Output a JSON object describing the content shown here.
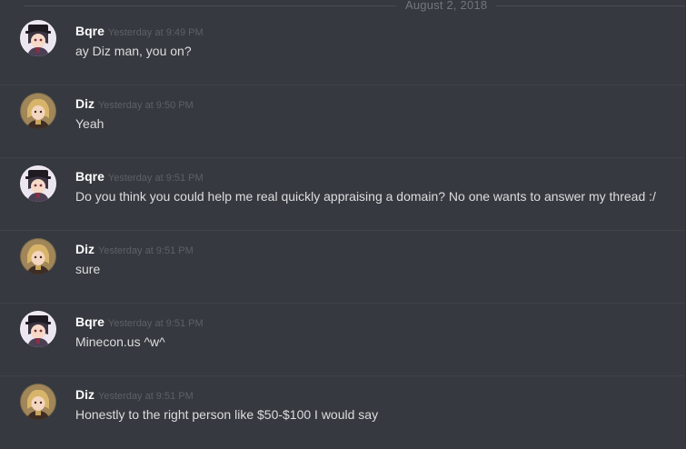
{
  "chat": {
    "date_divider": "August 2, 2018",
    "messages": [
      {
        "author": "Bqre",
        "timestamp": "Yesterday at 9:49 PM",
        "text": "ay Diz man, you on?",
        "avatar_icon": "avatar-bqre-icon"
      },
      {
        "author": "Diz",
        "timestamp": "Yesterday at 9:50 PM",
        "text": "Yeah",
        "avatar_icon": "avatar-diz-icon"
      },
      {
        "author": "Bqre",
        "timestamp": "Yesterday at 9:51 PM",
        "text": "Do you think you could help me real quickly appraising a domain? No one wants to answer my thread :/",
        "avatar_icon": "avatar-bqre-icon"
      },
      {
        "author": "Diz",
        "timestamp": "Yesterday at 9:51 PM",
        "text": "sure",
        "avatar_icon": "avatar-diz-icon"
      },
      {
        "author": "Bqre",
        "timestamp": "Yesterday at 9:51 PM",
        "text": "Minecon.us ^w^",
        "avatar_icon": "avatar-bqre-icon"
      },
      {
        "author": "Diz",
        "timestamp": "Yesterday at 9:51 PM",
        "text": "Honestly to the right person like $50-$100 I would say",
        "avatar_icon": "avatar-diz-icon"
      }
    ]
  },
  "colors": {
    "background": "#36393f",
    "username": "#ffffff",
    "timestamp": "#5d6167",
    "message_text": "#dcddde",
    "divider_text": "#72767d"
  }
}
